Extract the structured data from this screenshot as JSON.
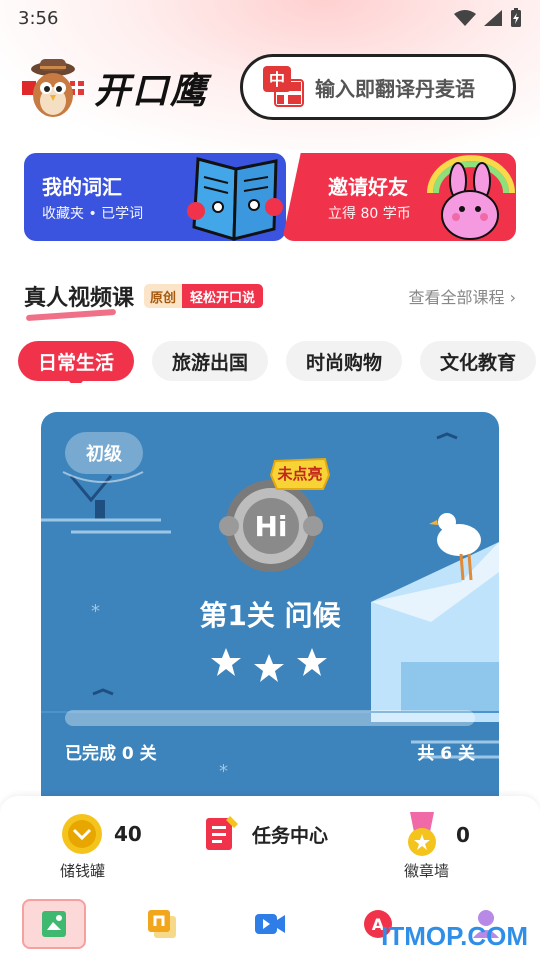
{
  "status_bar": {
    "time": "3:56"
  },
  "header": {
    "app_name": "开口鹰",
    "search": {
      "flag_label": "中",
      "placeholder": "输入即翻译丹麦语"
    }
  },
  "cards": [
    {
      "title": "我的词汇",
      "subtitle": "收藏夹 • 已学词"
    },
    {
      "title": "邀请好友",
      "subtitle": "立得 80 学币"
    }
  ],
  "section": {
    "title": "真人视频课",
    "tag_original": "原创",
    "tag_speak": "轻松开口说",
    "more": "查看全部课程"
  },
  "tabs": [
    {
      "label": "日常生活",
      "active": true
    },
    {
      "label": "旅游出国",
      "active": false
    },
    {
      "label": "时尚购物",
      "active": false
    },
    {
      "label": "文化教育",
      "active": false
    }
  ],
  "level_card": {
    "badge": "初级",
    "unlit_label": "未点亮",
    "medal_text": "Hi",
    "title": "第1关 问候",
    "stars": 3,
    "progress": 0,
    "completed": "已完成 0 关",
    "total": "共 6 关"
  },
  "bottom_bar": {
    "piggy": {
      "count": "40",
      "label": "储钱罐"
    },
    "task": {
      "label": "任务中心"
    },
    "badge_wall": {
      "count": "0",
      "label": "徽章墙"
    }
  },
  "nav": [
    "home-icon",
    "book-icon",
    "video-icon",
    "translate-icon",
    "profile-icon"
  ],
  "watermark": "ITMOP.COM",
  "colors": {
    "accent": "#f0334a",
    "blue_card": "#3a54e0",
    "level_bg": "#3d84bd"
  }
}
